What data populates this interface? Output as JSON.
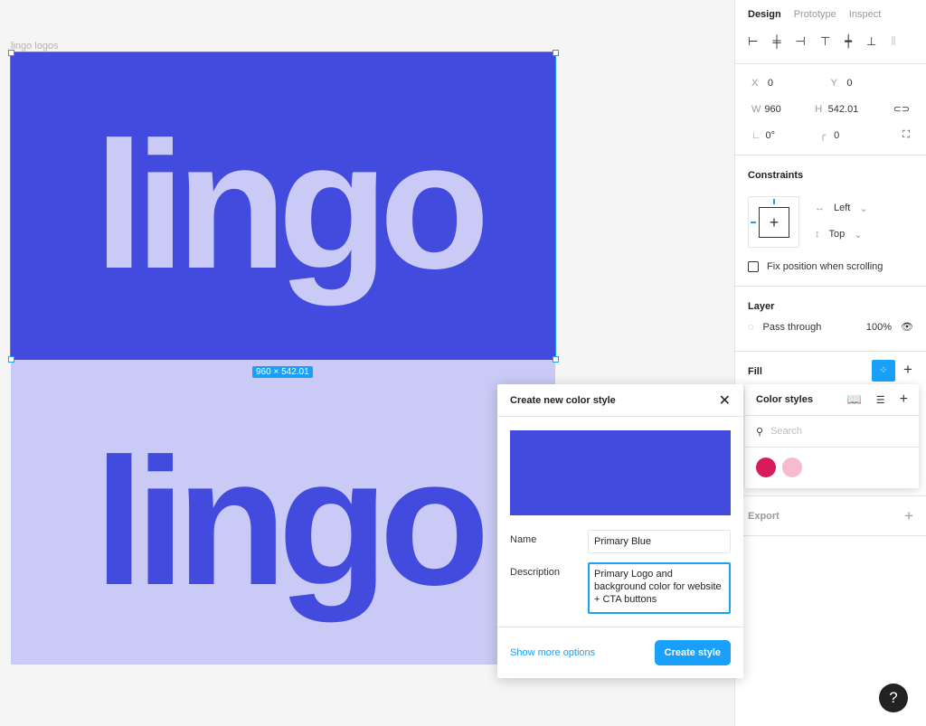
{
  "canvas": {
    "frame_label": "lingo logos",
    "logo_text": "lingo",
    "dimensions": "960 × 542.01",
    "colors": {
      "primary": "#434ade",
      "light": "#c9caf5"
    }
  },
  "panel": {
    "tabs": [
      "Design",
      "Prototype",
      "Inspect"
    ],
    "position": {
      "x_label": "X",
      "x": "0",
      "y_label": "Y",
      "y": "0",
      "w_label": "W",
      "w": "960",
      "h_label": "H",
      "h": "542.01",
      "rotation": "0°",
      "radius": "0"
    },
    "constraints": {
      "title": "Constraints",
      "horizontal": "Left",
      "vertical": "Top",
      "fix_label": "Fix position when scrolling",
      "fix_checked": false
    },
    "layer": {
      "title": "Layer",
      "blend": "Pass through",
      "opacity": "100%"
    },
    "fill": {
      "title": "Fill"
    },
    "export": {
      "title": "Export"
    }
  },
  "modal": {
    "title": "Create new color style",
    "swatch_color": "#434ade",
    "name_label": "Name",
    "name_value": "Primary Blue",
    "description_label": "Description",
    "description_value": "Primary Logo and background color for website + CTA buttons",
    "more_link": "Show more options",
    "create_button": "Create style"
  },
  "color_styles": {
    "title": "Color styles",
    "search_placeholder": "Search",
    "swatches": [
      "#d81b5a",
      "#f5bccd"
    ]
  },
  "help": {
    "label": "?"
  }
}
